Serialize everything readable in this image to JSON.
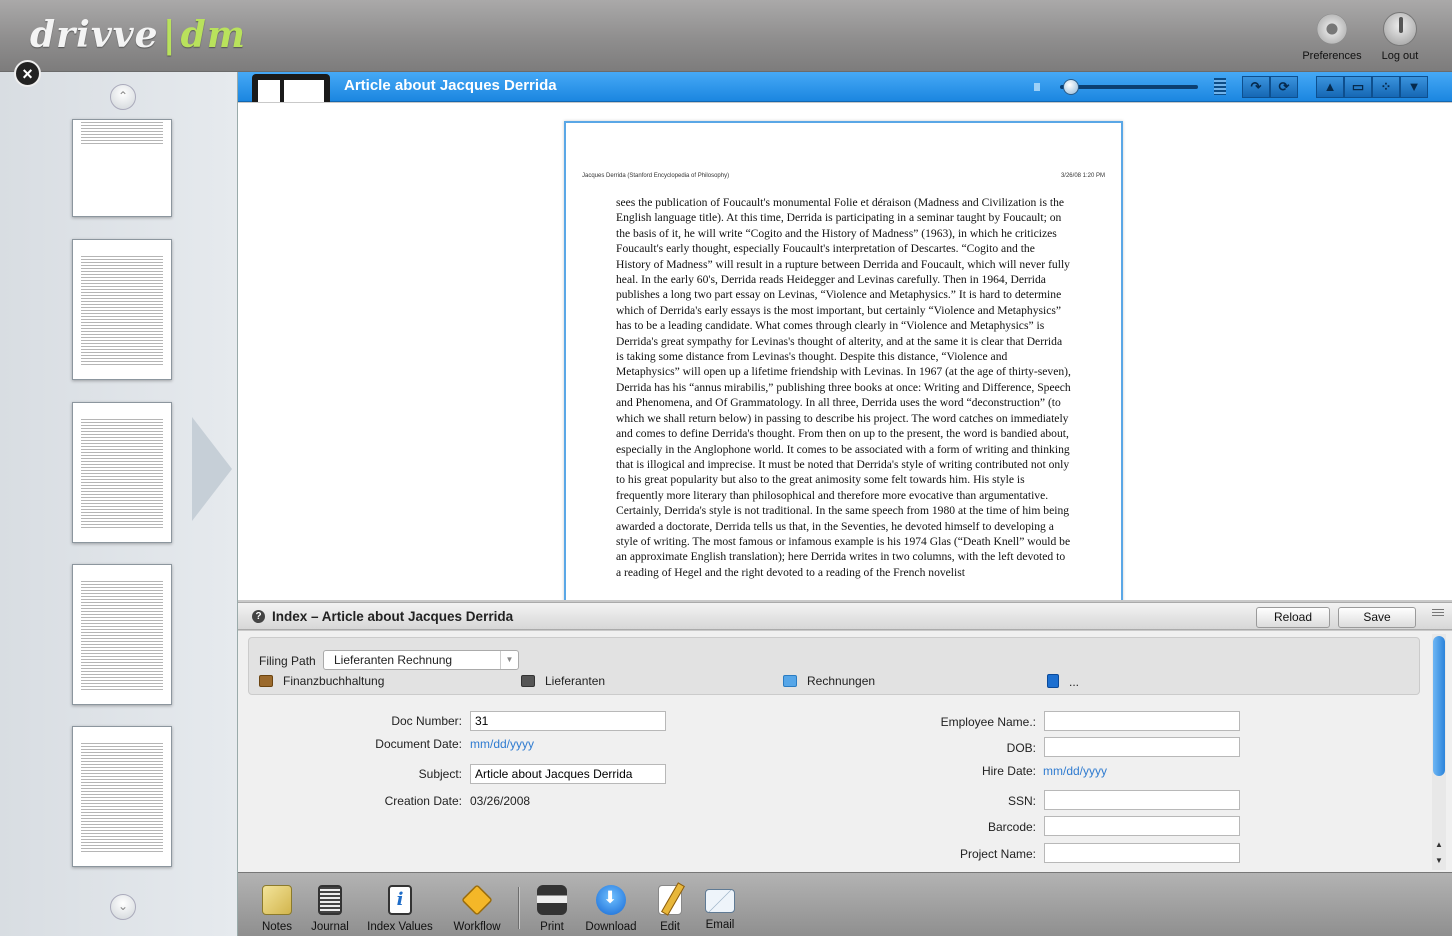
{
  "app": {
    "logo_main": "drivve",
    "logo_sep": "|",
    "logo_dm": "dm",
    "preferences_label": "Preferences",
    "logout_label": "Log out"
  },
  "viewer": {
    "title": "Article about Jacques Derrida",
    "zoom_level": 0.08,
    "page_header_left": "Jacques Derrida (Stanford Encyclopedia of Philosophy)",
    "page_header_right": "3/26/08 1:20 PM",
    "page_text": "sees the publication of Foucault's monumental Folie et déraison (Madness and Civilization is the English language title). At this time, Derrida is participating in a seminar taught by Foucault; on the basis of it, he will write “Cogito and the History of Madness” (1963), in which he criticizes Foucault's early thought, especially Foucault's interpretation of Descartes. “Cogito and the History of Madness” will result in a rupture between Derrida and Foucault, which will never fully heal. In the early 60's, Derrida reads Heidegger and Levinas carefully. Then in 1964, Derrida publishes a long two part essay on Levinas, “Violence and Metaphysics.” It is hard to determine which of Derrida's early essays is the most important, but certainly “Violence and Metaphysics” has to be a leading candidate. What comes through clearly in “Violence and Metaphysics” is Derrida's great sympathy for Levinas's thought of alterity, and at the same it is clear that Derrida is taking some distance from Levinas's thought. Despite this distance, “Violence and Metaphysics” will open up a lifetime friendship with Levinas. In 1967 (at the age of thirty-seven), Derrida has his “annus mirabilis,” publishing three books at once: Writing and Difference, Speech and Phenomena, and Of Grammatology. In all three, Derrida uses the word “deconstruction” (to which we shall return below) in passing to describe his project. The word catches on immediately and comes to define Derrida's thought. From then on up to the present, the word is bandied about, especially in the Anglophone world. It comes to be associated with a form of writing and thinking that is illogical and imprecise. It must be noted that Derrida's style of writing contributed not only to his great popularity but also to the great animosity some felt towards him. His style is frequently more literary than philosophical and therefore more evocative than argumentative. Certainly, Derrida's style is not traditional. In the same speech from 1980 at the time of him being awarded a doctorate, Derrida tells us that, in the Seventies, he devoted himself to developing a style of writing. The most famous or infamous example is his 1974 Glas (“Death Knell” would be an approximate English translation); here Derrida writes in two columns, with the left devoted to a reading of Hegel and the right devoted to a reading of the French novelist"
  },
  "index": {
    "title": "Index – Article about Jacques Derrida",
    "reload_label": "Reload",
    "save_label": "Save",
    "filing_path_label": "Filing Path",
    "filing_path_value": "Lieferanten Rechnung",
    "folders": [
      "Finanzbuchhaltung",
      "Lieferanten",
      "Rechnungen",
      "..."
    ],
    "fields_left": {
      "doc_number_label": "Doc Number:",
      "doc_number_value": "31",
      "document_date_label": "Document Date:",
      "document_date_value": "mm/dd/yyyy",
      "subject_label": "Subject:",
      "subject_value": "Article about Jacques Derrida",
      "creation_date_label": "Creation Date:",
      "creation_date_value": "03/26/2008"
    },
    "fields_right": {
      "employee_name_label": "Employee Name.:",
      "employee_name_value": "",
      "dob_label": "DOB:",
      "dob_value": "",
      "hire_date_label": "Hire Date:",
      "hire_date_value": "mm/dd/yyyy",
      "ssn_label": "SSN:",
      "ssn_value": "",
      "barcode_label": "Barcode:",
      "barcode_value": "",
      "project_name_label": "Project Name:",
      "project_name_value": ""
    }
  },
  "toolbar": {
    "notes": "Notes",
    "journal": "Journal",
    "index_values": "Index Values",
    "workflow": "Workflow",
    "print": "Print",
    "download": "Download",
    "edit": "Edit",
    "email": "Email"
  },
  "colors": {
    "accent_blue": "#1b86e0",
    "logo_green": "#b9e25c",
    "date_placeholder": "#2f7bd0"
  }
}
